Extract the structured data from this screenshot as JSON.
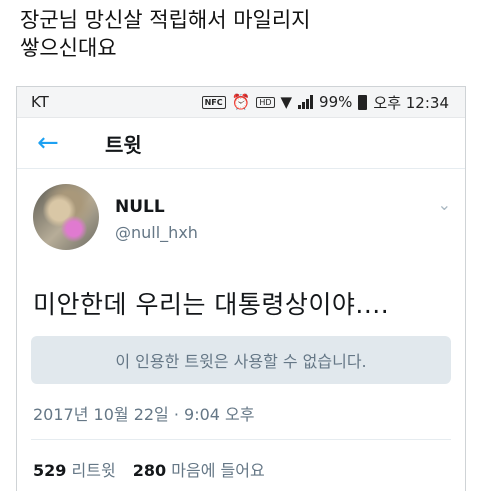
{
  "caption": {
    "line1": "장군님 망신살 적립해서 마일리지",
    "line2": "쌓으신대요"
  },
  "statusbar": {
    "carrier": "KT",
    "nfc": "NFC",
    "alarm": "⏰",
    "hd": "HD",
    "wifi": "▼",
    "battery": "99%",
    "time": "오후 12:34"
  },
  "header": {
    "back_icon": "←",
    "title": "트윗"
  },
  "tweet": {
    "name": "NULL",
    "handle": "@null_hxh",
    "text": "미안한데 우리는 대통령상이야....",
    "unavailable": "이 인용한 트윗은 사용할 수 없습니다.",
    "timestamp": "2017년 10월 22일 · 9:04 오후",
    "retweets_count": "529",
    "retweets_label": "리트윗",
    "likes_count": "280",
    "likes_label": "마음에 들어요",
    "chevron": "⌄"
  }
}
